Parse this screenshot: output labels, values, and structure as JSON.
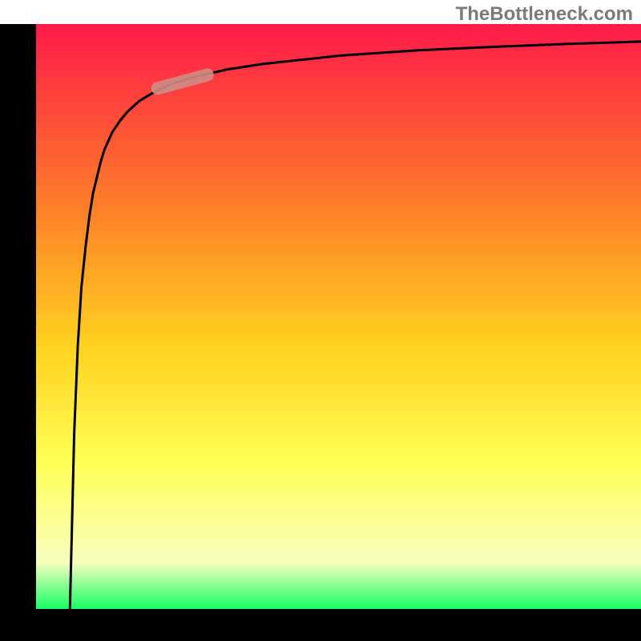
{
  "watermark": "TheBottleneck.com",
  "colors": {
    "axis_black": "#000000",
    "curve_black": "#000000",
    "highlight": "#cf8d84",
    "grad_top": "#ff1a4a",
    "grad_mid1": "#ff7a2a",
    "grad_mid2": "#ffd21f",
    "grad_mid3": "#ffff55",
    "grad_mid4": "#f8ffc0",
    "grad_bottom": "#18ff66"
  },
  "chart_data": {
    "type": "line",
    "title": "",
    "xlabel": "",
    "ylabel": "",
    "xlim": [
      0,
      100
    ],
    "ylim": [
      0,
      100
    ],
    "grid": false,
    "legend": false,
    "notes": "Axes are unlabeled; values are estimated on a 0-100 percent scale for both axes based on pixel positions.",
    "series": [
      {
        "name": "bottleneck-curve",
        "x": [
          5.6,
          6.3,
          6.9,
          7.5,
          8.2,
          8.8,
          9.4,
          10.1,
          10.7,
          11.3,
          12.6,
          13.9,
          15.1,
          17.0,
          18.9,
          22.0,
          25.2,
          31.4,
          37.7,
          50.3,
          62.9,
          75.5,
          88.0,
          100.0
        ],
        "y": [
          0.0,
          30.0,
          45.0,
          55.0,
          62.0,
          67.0,
          71.0,
          74.0,
          76.5,
          78.5,
          81.5,
          83.5,
          85.0,
          86.8,
          88.0,
          89.6,
          90.7,
          92.2,
          93.2,
          94.6,
          95.5,
          96.1,
          96.6,
          97.0
        ]
      }
    ],
    "highlight_segment": {
      "description": "Short thick pale-red segment overlaid on curve near top-left bend",
      "x_range": [
        20.1,
        28.3
      ],
      "y_range": [
        89.0,
        91.3
      ]
    },
    "background_gradient": {
      "orientation": "vertical",
      "stops": [
        {
          "pos": 0.0,
          "color": "#ff1a4a"
        },
        {
          "pos": 0.3,
          "color": "#ff7a2a"
        },
        {
          "pos": 0.55,
          "color": "#ffd21f"
        },
        {
          "pos": 0.75,
          "color": "#ffff55"
        },
        {
          "pos": 0.92,
          "color": "#f8ffc0"
        },
        {
          "pos": 1.0,
          "color": "#18ff66"
        }
      ]
    }
  }
}
